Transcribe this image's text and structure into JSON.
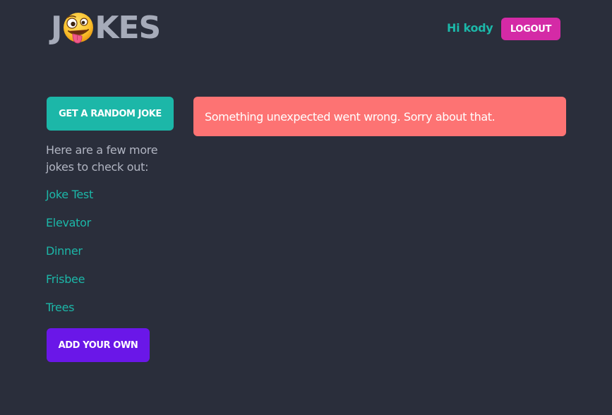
{
  "header": {
    "logo_left": "J",
    "logo_right": "KES",
    "logo_emoji_icon": "zany-face-icon",
    "greeting": "Hi kody",
    "logout_label": "LOGOUT"
  },
  "sidebar": {
    "random_button_label": "GET A RANDOM JOKE",
    "more_text": "Here are a few more jokes to check out:",
    "jokes": [
      "Joke Test",
      "Elevator",
      "Dinner",
      "Frisbee",
      "Trees"
    ],
    "add_button_label": "ADD YOUR OWN"
  },
  "main": {
    "error_message": "Something unexpected went wrong. Sorry about that."
  },
  "colors": {
    "background": "#2a2e3b",
    "teal": "#1cb7a8",
    "magenta": "#d42aa6",
    "purple": "#6a17e8",
    "error": "#fd7373",
    "logo_gray": "#a6abb9"
  }
}
